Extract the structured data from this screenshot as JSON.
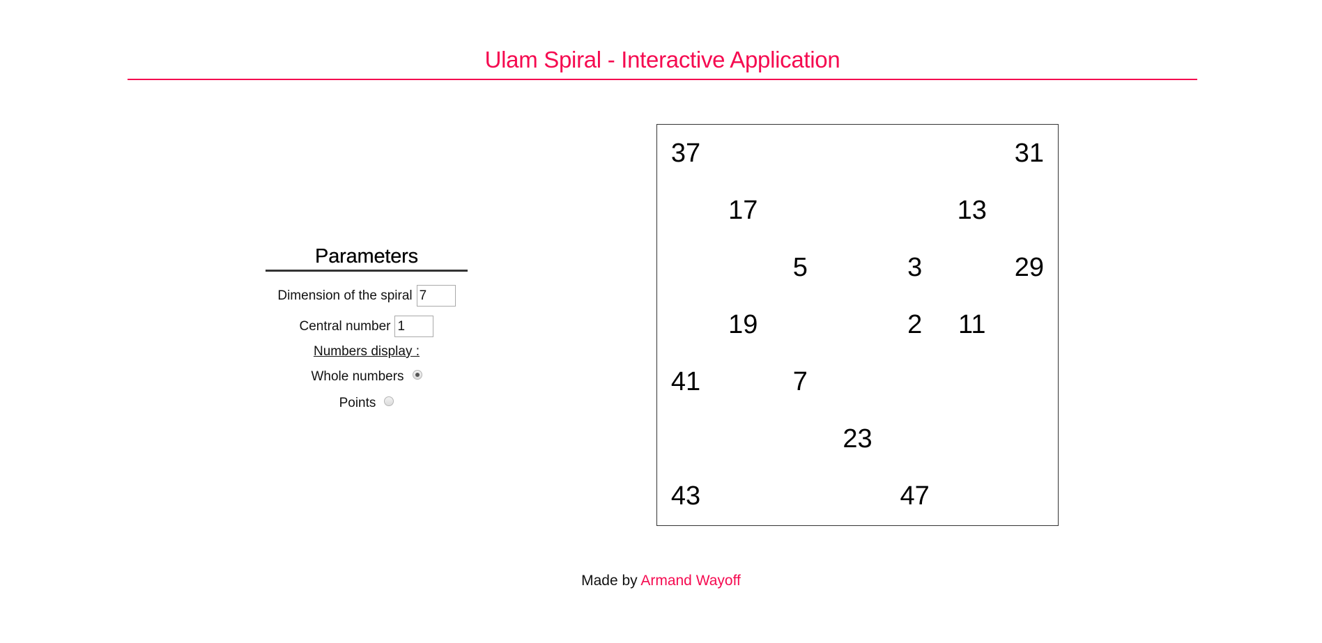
{
  "header": {
    "title": "Ulam Spiral - Interactive Application"
  },
  "parameters": {
    "title": "Parameters",
    "dimension_label": "Dimension of the spiral",
    "dimension_value": "7",
    "central_label": "Central number",
    "central_value": "1",
    "display_label": "Numbers display :",
    "options": [
      {
        "label": "Whole numbers",
        "checked": true
      },
      {
        "label": "Points",
        "checked": false
      }
    ]
  },
  "spiral": {
    "dimension": 7,
    "central_number": 1,
    "display_mode": "whole numbers",
    "cells": [
      {
        "value": "37",
        "row": 0,
        "col": 0
      },
      {
        "value": "31",
        "row": 0,
        "col": 6
      },
      {
        "value": "17",
        "row": 1,
        "col": 1
      },
      {
        "value": "13",
        "row": 1,
        "col": 5
      },
      {
        "value": "5",
        "row": 2,
        "col": 2
      },
      {
        "value": "3",
        "row": 2,
        "col": 4
      },
      {
        "value": "29",
        "row": 2,
        "col": 6
      },
      {
        "value": "19",
        "row": 3,
        "col": 1
      },
      {
        "value": "2",
        "row": 3,
        "col": 4
      },
      {
        "value": "11",
        "row": 3,
        "col": 5
      },
      {
        "value": "41",
        "row": 4,
        "col": 0
      },
      {
        "value": "7",
        "row": 4,
        "col": 2
      },
      {
        "value": "23",
        "row": 5,
        "col": 3
      },
      {
        "value": "43",
        "row": 6,
        "col": 0
      },
      {
        "value": "47",
        "row": 6,
        "col": 4
      }
    ]
  },
  "footer": {
    "prefix": "Made by",
    "author": "Armand Wayoff"
  },
  "colors": {
    "accent": "#F50A50",
    "text": "#111111",
    "border": "#333333"
  }
}
